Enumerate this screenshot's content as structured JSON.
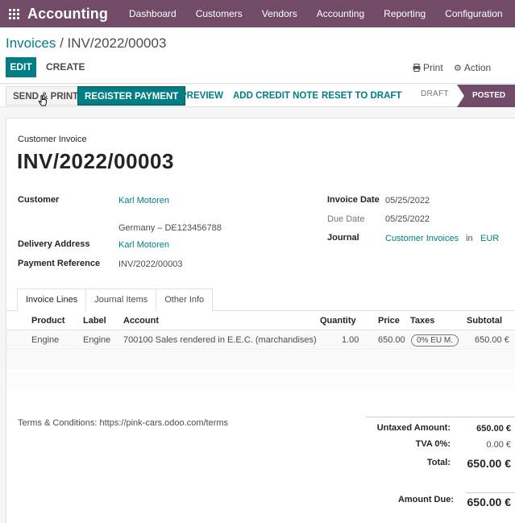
{
  "topbar": {
    "app_name": "Accounting",
    "menu": [
      "Dashboard",
      "Customers",
      "Vendors",
      "Accounting",
      "Reporting",
      "Configuration"
    ]
  },
  "breadcrumb": {
    "parent": "Invoices",
    "separator": " / ",
    "current": "INV/2022/00003"
  },
  "toolbar": {
    "edit_label": "EDIT",
    "create_label": "CREATE",
    "print_label": "Print",
    "action_label": "Action"
  },
  "statusbar": {
    "send_print_label": "SEND & PRINT",
    "register_payment_label": "REGISTER PAYMENT",
    "preview_label": "PREVIEW",
    "add_credit_note_label": "ADD CREDIT NOTE",
    "reset_to_draft_label": "RESET TO DRAFT",
    "stage_draft": "DRAFT",
    "stage_posted": "POSTED"
  },
  "invoice": {
    "type_label": "Customer Invoice",
    "number": "INV/2022/00003",
    "customer_label": "Customer",
    "customer_name": "Karl Motoren",
    "customer_address": "Germany – DE123456788",
    "delivery_label": "Delivery Address",
    "delivery_name": "Karl Motoren",
    "payment_ref_label": "Payment Reference",
    "payment_ref": "INV/2022/00003",
    "invoice_date_label": "Invoice Date",
    "invoice_date": "05/25/2022",
    "due_date_label": "Due Date",
    "due_date": "05/25/2022",
    "journal_label": "Journal",
    "journal": "Customer Invoices",
    "journal_in": "in",
    "currency": "EUR"
  },
  "tabs": [
    "Invoice Lines",
    "Journal Items",
    "Other Info"
  ],
  "lines": {
    "columns": [
      "Product",
      "Label",
      "Account",
      "Quantity",
      "Price",
      "Taxes",
      "Subtotal"
    ],
    "rows": [
      {
        "product": "Engine",
        "label": "Engine",
        "account": "700100 Sales rendered in E.E.C. (marchandises)",
        "quantity": "1.00",
        "price": "650.00",
        "taxes": "0% EU M.",
        "subtotal": "650.00 €"
      }
    ]
  },
  "terms": "Terms & Conditions: https://pink-cars.odoo.com/terms",
  "totals": {
    "untaxed_label": "Untaxed Amount:",
    "untaxed_value": "650.00 €",
    "tva_label": "TVA 0%:",
    "tva_value": "0.00 €",
    "total_label": "Total:",
    "total_value": "650.00 €",
    "due_label": "Amount Due:",
    "due_value": "650.00 €"
  },
  "colors": {
    "brand": "#714b67",
    "accent": "#017e84"
  }
}
